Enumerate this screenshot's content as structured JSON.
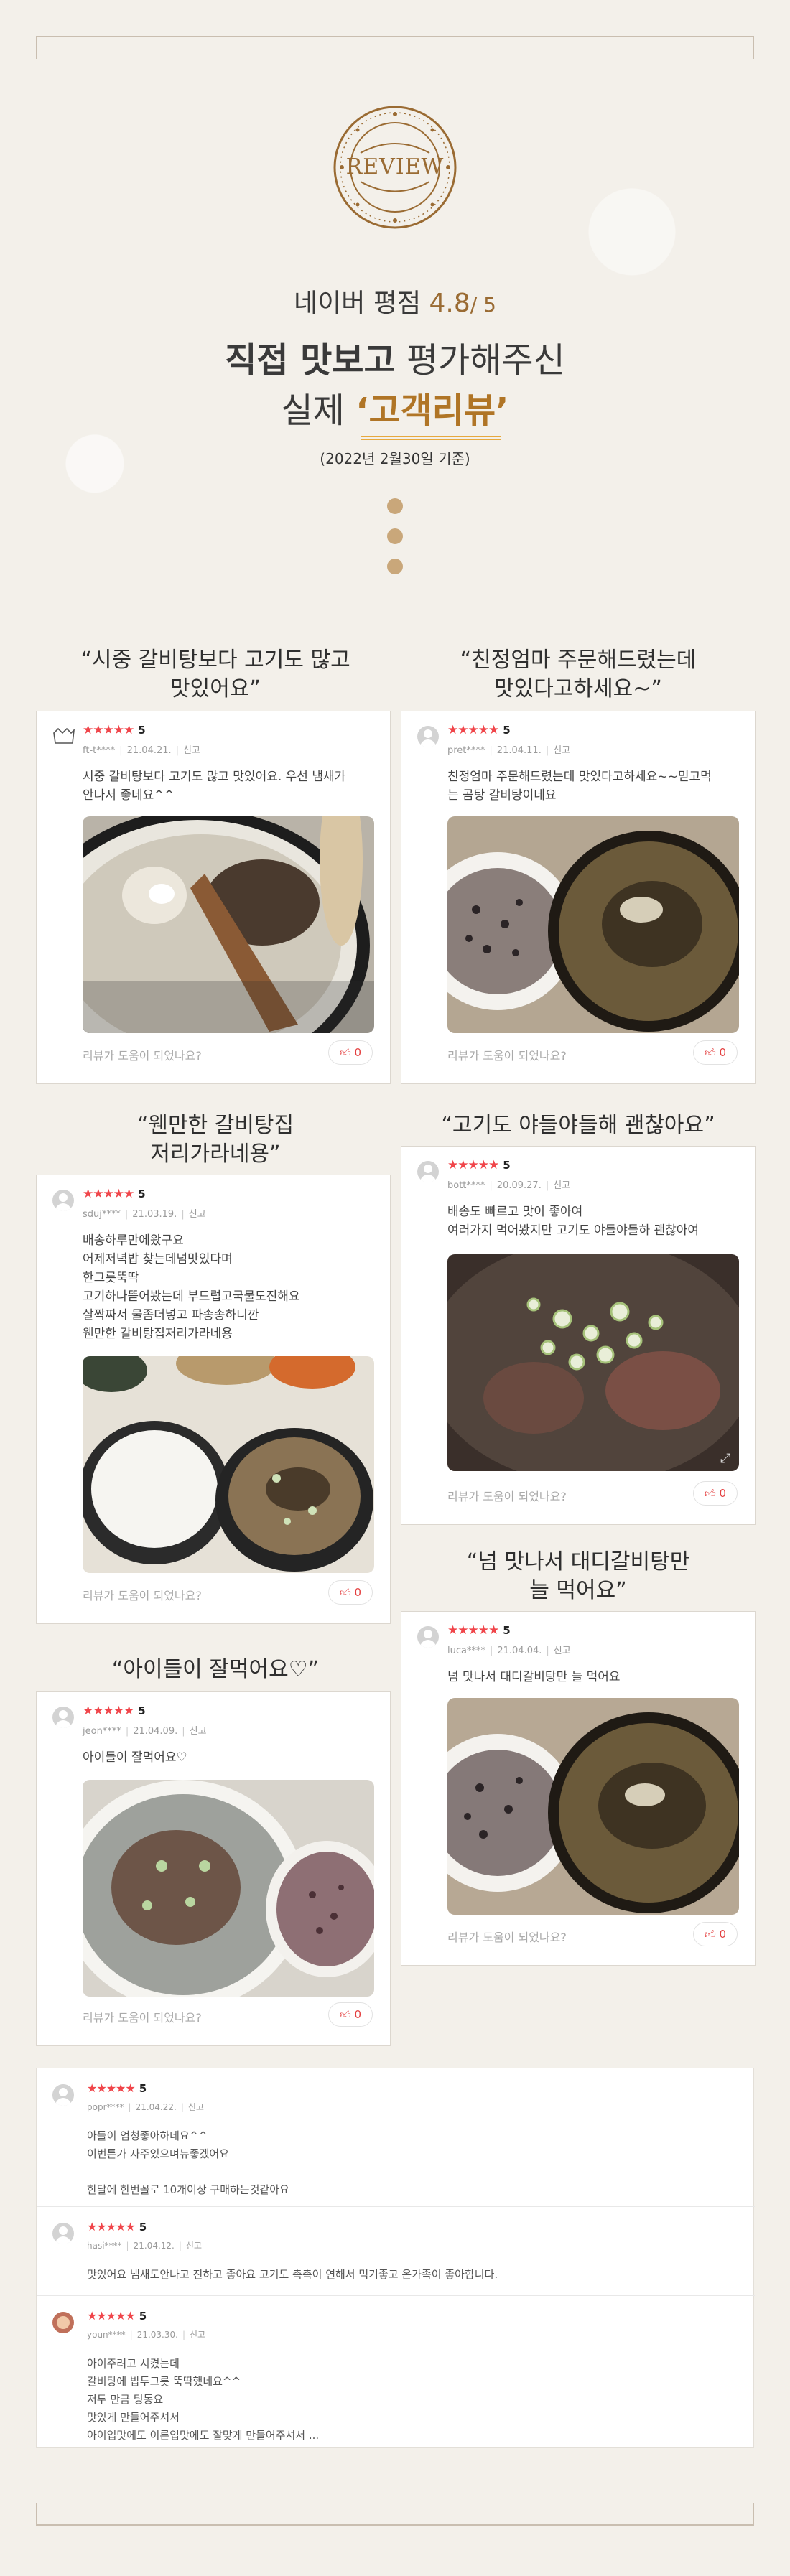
{
  "header": {
    "seal_text": "REVIEW",
    "rating_label": "네이버 평점",
    "rating_value": "4.8",
    "rating_max": "/ 5",
    "line2_bold": "직접 맛보고",
    "line2_light": "평가해주신",
    "line3_prefix": "실제",
    "line3_quote": "‘고객리뷰’",
    "basis_note": "(2022년 2월30일 기준)"
  },
  "common": {
    "helpful_text": "리뷰가 도움이 되었나요?"
  },
  "colors": {
    "accent_brown": "#9a6b33",
    "star_red": "#f0454a",
    "quote_gold": "#b07526"
  },
  "reviews": [
    {
      "title": "“시중 갈비탕보다 고기도 많고\n맛있어요”",
      "stars": "★★★★★",
      "score": "5",
      "user": "ft-t****",
      "date": "21.04.21.",
      "report": "신고",
      "text": "시중 갈비탕보다 고기도 많고 맛있어요. 우선 냄새가\n안나서 좋네요^^",
      "likes": "0",
      "like_icon": "thumbs-up-icon"
    },
    {
      "title": "“친정엄마 주문해드렸는데\n맛있다고하세요~”",
      "stars": "★★★★★",
      "score": "5",
      "user": "pret****",
      "date": "21.04.11.",
      "report": "신고",
      "text": "친정엄마 주문해드렸는데 맛있다고하세요~~믿고먹\n는 곰탕 갈비탕이네요",
      "likes": "0",
      "like_icon": "thumbs-up-icon"
    },
    {
      "title": "“웬만한 갈비탕집\n저리가라네용”",
      "stars": "★★★★★",
      "score": "5",
      "user": "sduj****",
      "date": "21.03.19.",
      "report": "신고",
      "text": "배송하루만에왔구요\n어제저녁밥 찾는데넘맛있다며\n한그릇뚝딱\n고기하나뜯어봤는데 부드럽고국물도진해요\n살짝짜서 물좀더넣고 파송송하니깐\n웬만한 갈비탕집저리가라네용",
      "likes": "0",
      "like_icon": "thumbs-up-icon"
    },
    {
      "title": "“고기도 야들야들해 괜찮아요”",
      "stars": "★★★★★",
      "score": "5",
      "user": "bott****",
      "date": "20.09.27.",
      "report": "신고",
      "text": "배송도 빠르고 맛이 좋아여\n여러가지 먹어봤지만 고기도 야들야들하 괜찮아여",
      "likes": "0",
      "like_icon": "thumbs-up-icon"
    },
    {
      "title": "“넘 맛나서 대디갈비탕만\n늘 먹어요”",
      "stars": "★★★★★",
      "score": "5",
      "user": "luca****",
      "date": "21.04.04.",
      "report": "신고",
      "text": "넘 맛나서 대디갈비탕만 늘 먹어요",
      "likes": "0",
      "like_icon": "thumbs-up-icon"
    },
    {
      "title": "“아이들이 잘먹어요♡”",
      "stars": "★★★★★",
      "score": "5",
      "user": "jeon****",
      "date": "21.04.09.",
      "report": "신고",
      "text": "아이들이 잘먹어요♡",
      "likes": "0",
      "like_icon": "thumbs-up-icon"
    }
  ],
  "list_reviews": [
    {
      "stars": "★★★★★",
      "score": "5",
      "user": "popr****",
      "date": "21.04.22.",
      "report": "신고",
      "text": "아들이 엄청좋아하네요^^\n이번튼가 자주있으며뉴좋겠어요\n\n한달에 한번꼴로 10개이상 구매하는것같아요"
    },
    {
      "stars": "★★★★★",
      "score": "5",
      "user": "hasi****",
      "date": "21.04.12.",
      "report": "신고",
      "text": "맛있어요 냄새도안나고 진하고 좋아요 고기도 촉촉이 연해서 먹기좋고 온가족이 좋아합니다."
    },
    {
      "stars": "★★★★★",
      "score": "5",
      "user": "youn****",
      "date": "21.03.30.",
      "report": "신고",
      "text": "아이주려고 시켰는데\n갈비탕에 밥투그릇 뚝딱했네요^^\n저두 만금 팅동요\n맛있게 만들어주셔서\n아이입맛에도 이른입맛에도 잘맞게 만들어주셔서 ..."
    }
  ]
}
